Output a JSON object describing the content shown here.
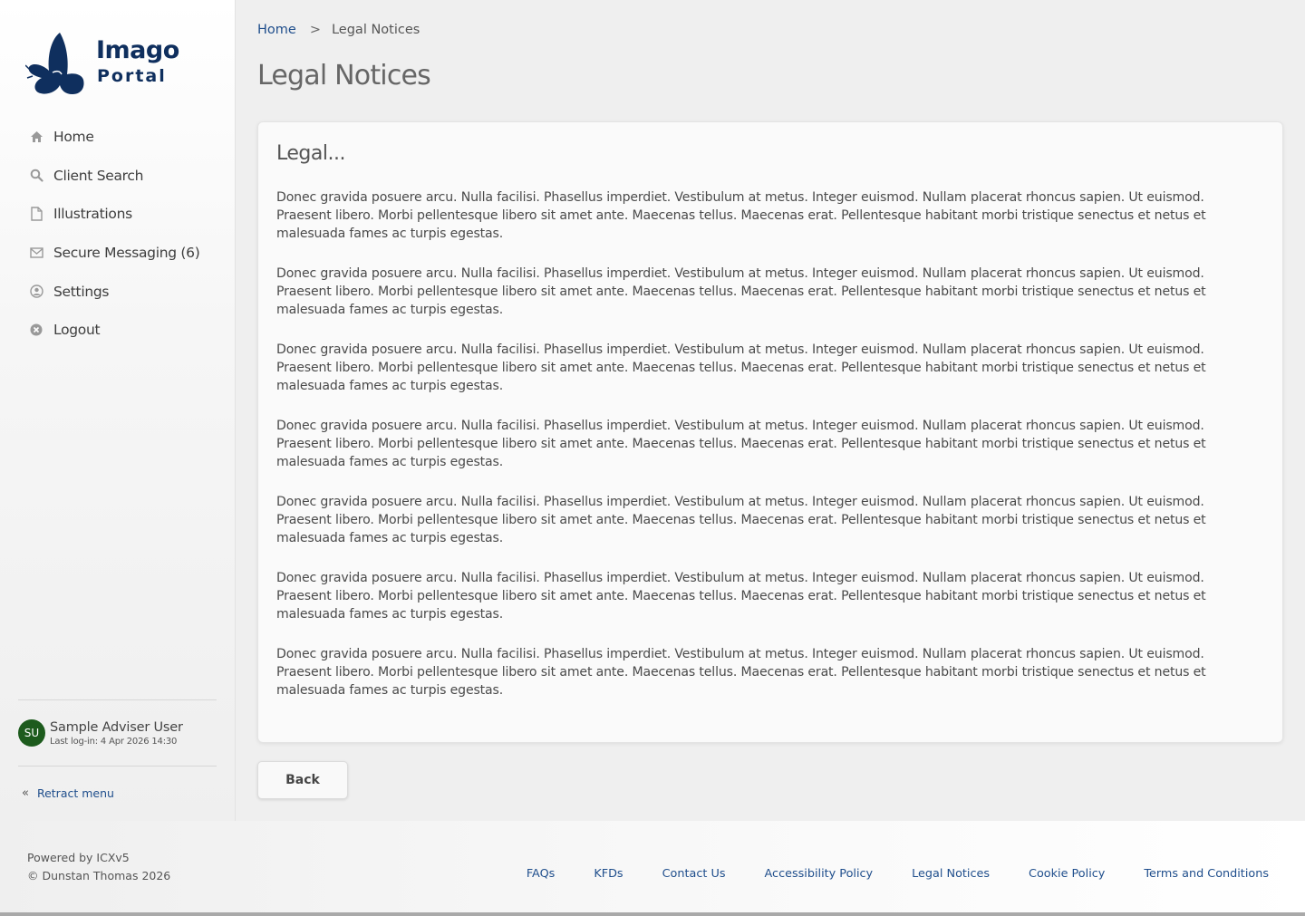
{
  "brand": {
    "name": "Imago",
    "subtitle": "Portal"
  },
  "colors": {
    "brand_navy": "#0f2f5e",
    "link_blue": "#1f4e8c",
    "avatar_green": "#1d5b1d"
  },
  "sidebar": {
    "items": [
      {
        "label": "Home",
        "icon": "home-icon"
      },
      {
        "label": "Client Search",
        "icon": "search-icon"
      },
      {
        "label": "Illustrations",
        "icon": "document-icon"
      },
      {
        "label": "Secure Messaging (6)",
        "icon": "envelope-icon"
      },
      {
        "label": "Settings",
        "icon": "user-circle-icon"
      },
      {
        "label": "Logout",
        "icon": "close-circle-icon"
      }
    ],
    "user": {
      "initials": "SU",
      "name": "Sample Adviser User",
      "last_login": "Last log-in: 4 Apr 2026 14:30"
    },
    "retract_label": "Retract menu"
  },
  "breadcrumb": {
    "home": "Home",
    "separator": ">",
    "current": "Legal Notices"
  },
  "page": {
    "title": "Legal Notices",
    "card_title": "Legal...",
    "paragraphs": [
      "Donec gravida posuere arcu. Nulla facilisi. Phasellus imperdiet. Vestibulum at metus. Integer euismod. Nullam placerat rhoncus sapien. Ut euismod. Praesent libero. Morbi pellentesque libero sit amet ante. Maecenas tellus. Maecenas erat. Pellentesque habitant morbi tristique senectus et netus et malesuada fames ac turpis egestas.",
      "Donec gravida posuere arcu. Nulla facilisi. Phasellus imperdiet. Vestibulum at metus. Integer euismod. Nullam placerat rhoncus sapien. Ut euismod. Praesent libero. Morbi pellentesque libero sit amet ante. Maecenas tellus. Maecenas erat. Pellentesque habitant morbi tristique senectus et netus et malesuada fames ac turpis egestas.",
      "Donec gravida posuere arcu. Nulla facilisi. Phasellus imperdiet. Vestibulum at metus. Integer euismod. Nullam placerat rhoncus sapien. Ut euismod. Praesent libero. Morbi pellentesque libero sit amet ante. Maecenas tellus. Maecenas erat. Pellentesque habitant morbi tristique senectus et netus et malesuada fames ac turpis egestas.",
      "Donec gravida posuere arcu. Nulla facilisi. Phasellus imperdiet. Vestibulum at metus. Integer euismod. Nullam placerat rhoncus sapien. Ut euismod. Praesent libero. Morbi pellentesque libero sit amet ante. Maecenas tellus. Maecenas erat. Pellentesque habitant morbi tristique senectus et netus et malesuada fames ac turpis egestas.",
      "Donec gravida posuere arcu. Nulla facilisi. Phasellus imperdiet. Vestibulum at metus. Integer euismod. Nullam placerat rhoncus sapien. Ut euismod. Praesent libero. Morbi pellentesque libero sit amet ante. Maecenas tellus. Maecenas erat. Pellentesque habitant morbi tristique senectus et netus et malesuada fames ac turpis egestas.",
      "Donec gravida posuere arcu. Nulla facilisi. Phasellus imperdiet. Vestibulum at metus. Integer euismod. Nullam placerat rhoncus sapien. Ut euismod. Praesent libero. Morbi pellentesque libero sit amet ante. Maecenas tellus. Maecenas erat. Pellentesque habitant morbi tristique senectus et netus et malesuada fames ac turpis egestas.",
      "Donec gravida posuere arcu. Nulla facilisi. Phasellus imperdiet. Vestibulum at metus. Integer euismod. Nullam placerat rhoncus sapien. Ut euismod. Praesent libero. Morbi pellentesque libero sit amet ante. Maecenas tellus. Maecenas erat. Pellentesque habitant morbi tristique senectus et netus et malesuada fames ac turpis egestas."
    ],
    "back_label": "Back"
  },
  "footer": {
    "powered_by": "Powered by ICXv5",
    "copyright": "© Dunstan Thomas 2026",
    "links": [
      "FAQs",
      "KFDs",
      "Contact Us",
      "Accessibility Policy",
      "Legal Notices",
      "Cookie Policy",
      "Terms and Conditions"
    ]
  }
}
